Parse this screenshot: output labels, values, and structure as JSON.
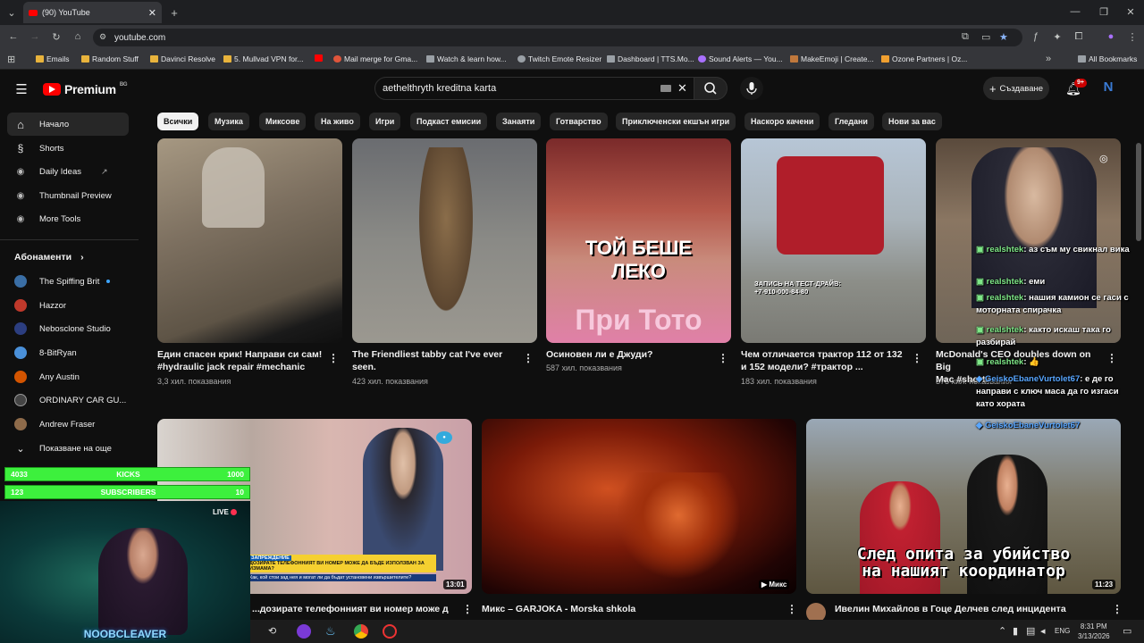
{
  "browser": {
    "tab_title": "(90) YouTube",
    "url": "youtube.com",
    "bookmarks": [
      {
        "label": "Emails",
        "color": "#e8b33c"
      },
      {
        "label": "Random Stuff",
        "color": "#e8b33c"
      },
      {
        "label": "Davinci Resolve",
        "color": "#e8b33c"
      },
      {
        "label": "5. Mullvad VPN for...",
        "color": "#e8b33c"
      },
      {
        "label": "",
        "color": "#ff0000"
      },
      {
        "label": "Mail merge for Gma...",
        "color": "#e0553b"
      },
      {
        "label": "Watch & learn how...",
        "color": "#9aa0a6"
      },
      {
        "label": "Twitch Emote Resizer",
        "color": "#9aa0a6"
      },
      {
        "label": "Dashboard | TTS.Mo...",
        "color": "#9aa0a6"
      },
      {
        "label": "Sound Alerts — You...",
        "color": "#a970ff"
      },
      {
        "label": "MakeEmoji | Create...",
        "color": "#c0783c"
      },
      {
        "label": "Ozone Partners | Oz...",
        "color": "#f0a030"
      }
    ],
    "all_bookmarks": "All Bookmarks"
  },
  "yt": {
    "logo": "Premium",
    "logo_region": "BG",
    "search_value": "aethelthryth kreditna karta",
    "create_label": "Създаване",
    "notif_count": "9+",
    "account_initial": "N"
  },
  "sidebar": {
    "items": [
      {
        "label": "Начало",
        "icon": "home-icon",
        "glyph": "⌂"
      },
      {
        "label": "Shorts",
        "icon": "shorts-icon",
        "glyph": "§"
      },
      {
        "label": "Daily Ideas",
        "icon": "daily-ideas-icon",
        "glyph": "◉"
      },
      {
        "label": "Thumbnail Preview",
        "icon": "thumbnail-preview-icon",
        "glyph": "◉"
      },
      {
        "label": "More Tools",
        "icon": "more-tools-icon",
        "glyph": "◉"
      }
    ],
    "subs_heading": "Абонаменти",
    "subs": [
      {
        "label": "The Spiffing Brit",
        "color": "#3a6ea5"
      },
      {
        "label": "Hazzor",
        "color": "#c0392b"
      },
      {
        "label": "Nebosclone Studio",
        "color": "#2c3e80"
      },
      {
        "label": "8-BitRyan",
        "color": "#4a90d9"
      },
      {
        "label": "Any Austin",
        "color": "#d35400"
      },
      {
        "label": "ORDINARY CAR GU...",
        "color": "#444"
      },
      {
        "label": "Andrew Fraser",
        "color": "#8e6b4a"
      }
    ],
    "show_more": "Показване на още"
  },
  "chips": [
    "Всички",
    "Музика",
    "Миксове",
    "На живо",
    "Игри",
    "Подкаст емисии",
    "Занаяти",
    "Готварство",
    "Приключенски екшън игри",
    "Наскоро качени",
    "Гледани",
    "Нови за вас"
  ],
  "row1": [
    {
      "title1": "Един спасен крик! Направи си сам!",
      "title2": "#hydraulic jack repair #mechanic",
      "meta": "3,3 хил. показвания"
    },
    {
      "title1": "The Friendliest tabby cat I've ever",
      "title2": "seen.",
      "meta": "423 хил. показвания"
    },
    {
      "title1": "Осиновен ли е Джуди?",
      "title2": "",
      "meta": "587 хил. показвания",
      "overlay1": "ТОЙ БЕШЕ",
      "overlay2": "ЛЕКО",
      "overlay3": "При Тото"
    },
    {
      "title1": "Чем отличается трактор 112 от 132",
      "title2": "и 152 модели? #трактор ...",
      "meta": "183 хил. показвания",
      "overlay1": "ЗАПИСЬ НА ТЕСТ-ДРАЙВ:",
      "overlay2": "+7-910-000-84-80"
    },
    {
      "title1": "McDonald's CEO doubles down on Big",
      "title2": "Mac #shorts",
      "meta": "375 хил. показвания"
    }
  ],
  "row2": [
    {
      "title": "...дозирате телефонният ви номер може да",
      "duration": "13:01",
      "banner1": "ЗАПРЕЖДЕНИЕ",
      "banner2": "ДОЗИРАТЕ ТЕЛЕФОННИЯТ ВИ НОМЕР МОЖЕ ДА БЪДЕ ИЗПОЛЗВАН ЗА ИЗМАМА?",
      "banner3": "Как, кой стои зад нея и могат ли да бъдат установени извършителите?"
    },
    {
      "title": "Микс – GARJOKA - Morska shkola",
      "duration": "Микс"
    },
    {
      "title": "Ивелин Михайлов в Гоце Делчев след инцидента",
      "duration": "11:23",
      "overlay1": "След опита за убийство",
      "overlay2": "на нашият координатор"
    }
  ],
  "chat": [
    {
      "user": "realshtek",
      "text": ": аз съм му свикнал вика"
    },
    {
      "user": "realshtek",
      "text": ": еми"
    },
    {
      "user": "realshtek",
      "text": ": нашия камион се гаси с моторната спирачка"
    },
    {
      "user": "realshtek",
      "text": ": както искаш така го разбирай"
    },
    {
      "user": "realshtek",
      "text": ": 👍"
    },
    {
      "user": "GeiskoEbaneVurtolet67",
      "text": ": е де го направи с ключ маса да го изгаси като хората"
    },
    {
      "user": "GeiskoEbaneVurtolet67",
      "text": ""
    }
  ],
  "stream": {
    "kicks_count": "4033",
    "kicks_label": "KICKS",
    "kicks_goal": "1000",
    "subs_count": "123",
    "subs_label": "SUBSCRIBERS",
    "subs_goal": "10",
    "live": "LIVE",
    "streamer": "NOOBCLEAVER"
  },
  "taskbar": {
    "lang": "ENG",
    "time": "8:31 PM",
    "date": "3/13/2026"
  }
}
